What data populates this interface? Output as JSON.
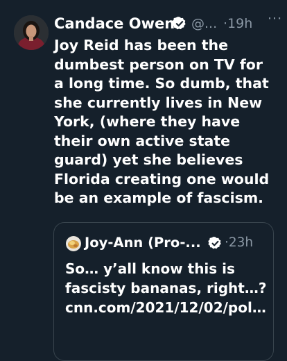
{
  "tweet": {
    "author_name": "Candace Owens",
    "handle": "@...",
    "time": "·19h",
    "more": "···",
    "text": "Joy Reid has been the dumbest person on TV for a long time. So dumb, that she currently lives in New York, (where they have their own active state guard) yet she believes Florida creating one would be an example of fascism.",
    "verified_color": "#ffffff"
  },
  "quote": {
    "author_name": "Joy-Ann (Pro-...",
    "time": "·23h",
    "text": "So… y’all know this is fascisty bananas, right…? cnn.com/2021/12/02/pol…"
  },
  "colors": {
    "background": "#15202b",
    "secondary_text": "#8b98a5",
    "border": "#38444d"
  }
}
